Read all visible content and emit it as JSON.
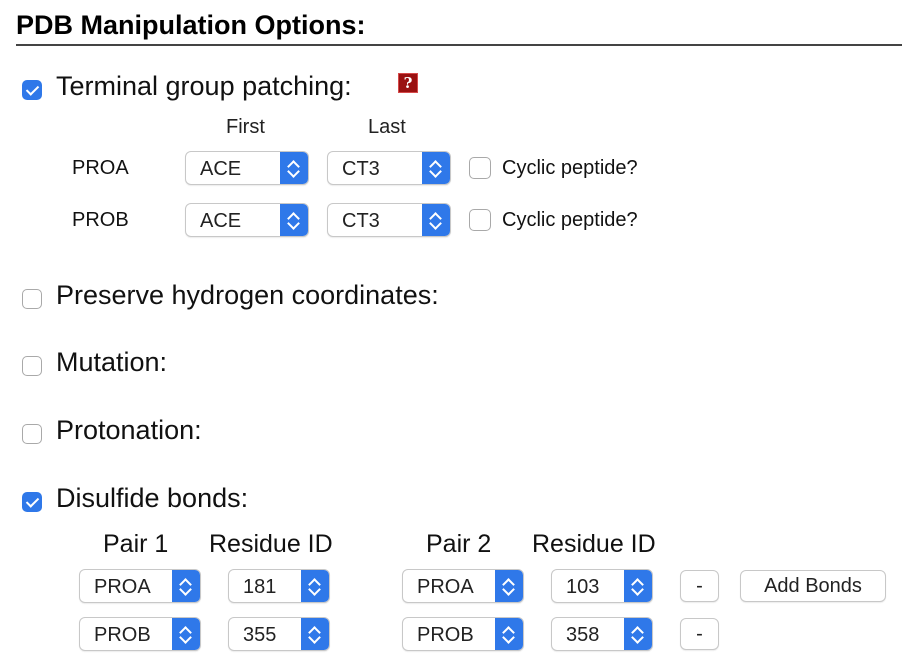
{
  "title": "PDB Manipulation Options:",
  "terminal": {
    "label": "Terminal group patching:",
    "checked": true,
    "help_icon": "help-question-icon",
    "col_first": "First",
    "col_last": "Last",
    "rows": [
      {
        "segment": "PROA",
        "first": "ACE",
        "last": "CT3",
        "cyclic_label": "Cyclic peptide?",
        "cyclic_checked": false
      },
      {
        "segment": "PROB",
        "first": "ACE",
        "last": "CT3",
        "cyclic_label": "Cyclic peptide?",
        "cyclic_checked": false
      }
    ]
  },
  "preserve_h": {
    "label": "Preserve hydrogen coordinates:",
    "checked": false
  },
  "mutation": {
    "label": "Mutation:",
    "checked": false
  },
  "protonation": {
    "label": "Protonation:",
    "checked": false
  },
  "disulfide": {
    "label": "Disulfide bonds:",
    "checked": true,
    "pair1_header": "Pair 1",
    "residue1_header": "Residue ID",
    "pair2_header": "Pair 2",
    "residue2_header": "Residue ID",
    "bonds": [
      {
        "seg1": "PROA",
        "res1": "181",
        "seg2": "PROA",
        "res2": "103",
        "remove_label": "-"
      },
      {
        "seg1": "PROB",
        "res1": "355",
        "seg2": "PROB",
        "res2": "358",
        "remove_label": "-"
      }
    ],
    "add_label": "Add Bonds"
  },
  "colors": {
    "accent": "#2f78e9",
    "help_icon_bg": "#9a1111"
  }
}
